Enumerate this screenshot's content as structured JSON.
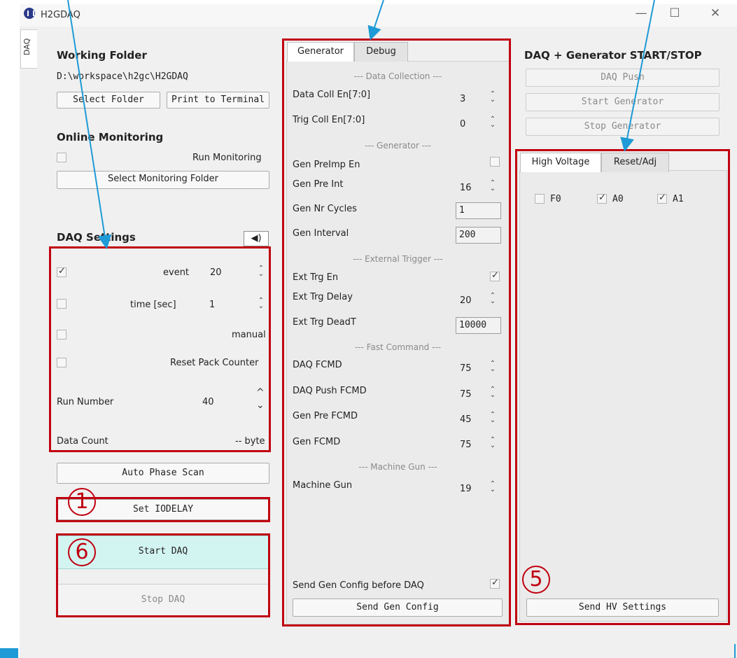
{
  "window": {
    "title": "H2GDAQ",
    "minimize": "—",
    "maximize": "☐",
    "close": "✕"
  },
  "side_tab": "DAQ",
  "left": {
    "working_folder_title": "Working Folder",
    "folder_path": "D:\\workspace\\h2gc\\H2GDAQ",
    "select_folder": "Select Folder",
    "print_terminal": "Print to Terminal",
    "online_monitoring_title": "Online Monitoring",
    "run_monitoring": "Run Monitoring",
    "select_monitoring_folder": "Select Monitoring Folder",
    "daq_settings_title": "DAQ Settings",
    "speaker_glyph": "◀)",
    "event_label": "event",
    "event_value": "20",
    "time_label": "time [sec]",
    "time_value": "1",
    "manual_label": "manual",
    "reset_pack_label": "Reset Pack Counter",
    "run_number_label": "Run Number",
    "run_number_value": "40",
    "data_count_label": "Data Count",
    "data_count_value": "-- byte",
    "auto_phase_scan": "Auto Phase Scan",
    "set_iodelay": "Set IODELAY",
    "start_daq": "Start DAQ",
    "stop_daq": "Stop DAQ"
  },
  "middle": {
    "tabs": [
      {
        "label": "Generator"
      },
      {
        "label": "Debug"
      }
    ],
    "sec_data_collection": "--- Data Collection ---",
    "data_coll_label": "Data Coll En[7:0]",
    "data_coll_value": "3",
    "trig_coll_label": "Trig Coll En[7:0]",
    "trig_coll_value": "0",
    "sec_generator": "--- Generator ---",
    "gen_preimp_label": "Gen PreImp En",
    "gen_pre_int_label": "Gen Pre Int",
    "gen_pre_int_value": "16",
    "gen_nr_cycles_label": "Gen Nr Cycles",
    "gen_nr_cycles_value": "1",
    "gen_interval_label": "Gen Interval",
    "gen_interval_value": "200",
    "sec_external_trigger": "--- External Trigger ---",
    "ext_trg_en_label": "Ext Trg En",
    "ext_trg_delay_label": "Ext Trg Delay",
    "ext_trg_delay_value": "20",
    "ext_trg_deadt_label": "Ext Trg DeadT",
    "ext_trg_deadt_value": "10000",
    "sec_fast_command": "--- Fast Command ---",
    "daq_fcmd_label": "DAQ FCMD",
    "daq_fcmd_value": "75",
    "daq_push_fcmd_label": "DAQ Push FCMD",
    "daq_push_fcmd_value": "75",
    "gen_pre_fcmd_label": "Gen Pre FCMD",
    "gen_pre_fcmd_value": "45",
    "gen_fcmd_label": "Gen FCMD",
    "gen_fcmd_value": "75",
    "sec_machine_gun": "--- Machine Gun ---",
    "machine_gun_label": "Machine Gun",
    "machine_gun_value": "19",
    "send_gen_config_before_daq": "Send Gen Config before DAQ",
    "send_gen_config": "Send Gen Config"
  },
  "right": {
    "title": "DAQ + Generator START/STOP",
    "daq_push": "DAQ Push",
    "start_generator": "Start Generator",
    "stop_generator": "Stop Generator",
    "tabs": [
      {
        "label": "High Voltage"
      },
      {
        "label": "Reset/Adj"
      }
    ],
    "hv_f0": "F0",
    "hv_a0": "A0",
    "hv_a1": "A1",
    "send_hv_settings": "Send HV Settings"
  },
  "annotations": {
    "c1": "1",
    "c5": "5",
    "c6": "6"
  },
  "colors": {
    "annotation_red": "#c0000f",
    "arrow_blue": "#1e9ad6",
    "start_daq_bg": "#d3f5f1"
  }
}
